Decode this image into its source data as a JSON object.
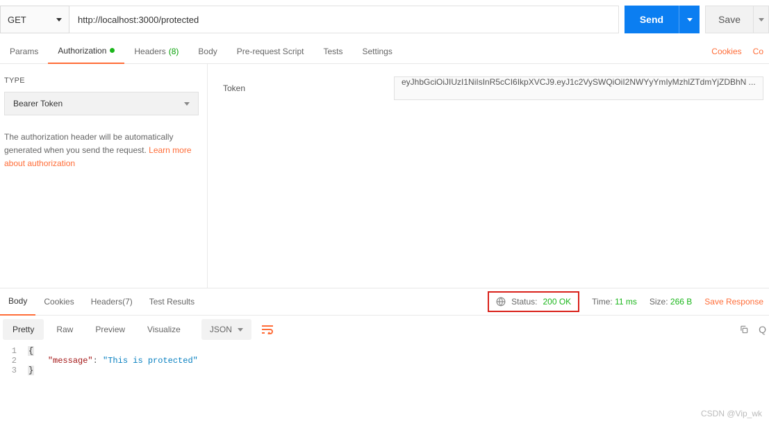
{
  "request": {
    "method": "GET",
    "url": "http://localhost:3000/protected",
    "send_label": "Send",
    "save_label": "Save"
  },
  "tabs": {
    "params": "Params",
    "auth": "Authorization",
    "headers": "Headers",
    "headers_count": "(8)",
    "body": "Body",
    "prereq": "Pre-request Script",
    "tests": "Tests",
    "settings": "Settings",
    "cookies": "Cookies",
    "code": "Co"
  },
  "auth": {
    "type_label": "TYPE",
    "type_value": "Bearer Token",
    "desc1": "The authorization header will be automatically generated when you send the request. ",
    "learn": "Learn more about authorization",
    "token_label": "Token",
    "token_value": "eyJhbGciOiJIUzI1NiIsInR5cCI6IkpXVCJ9.eyJ1c2VySWQiOiI2NWYyYmIyMzhlZTdmYjZDBhN ..."
  },
  "response_tabs": {
    "body": "Body",
    "cookies": "Cookies",
    "headers": "Headers",
    "headers_count": "(7)",
    "test_results": "Test Results"
  },
  "status": {
    "status_label": "Status:",
    "status_value": "200 OK",
    "time_label": "Time:",
    "time_value": "11 ms",
    "size_label": "Size:",
    "size_value": "266 B",
    "save_response": "Save Response"
  },
  "body_toolbar": {
    "pretty": "Pretty",
    "raw": "Raw",
    "preview": "Preview",
    "visualize": "Visualize",
    "json": "JSON",
    "search_placeholder": "Q"
  },
  "code": {
    "l1": "1",
    "l2": "2",
    "l3": "3",
    "open": "{",
    "close": "}",
    "key": "\"message\"",
    "colon": ": ",
    "val": "\"This is protected\""
  },
  "watermark": "CSDN @Vip_wk"
}
